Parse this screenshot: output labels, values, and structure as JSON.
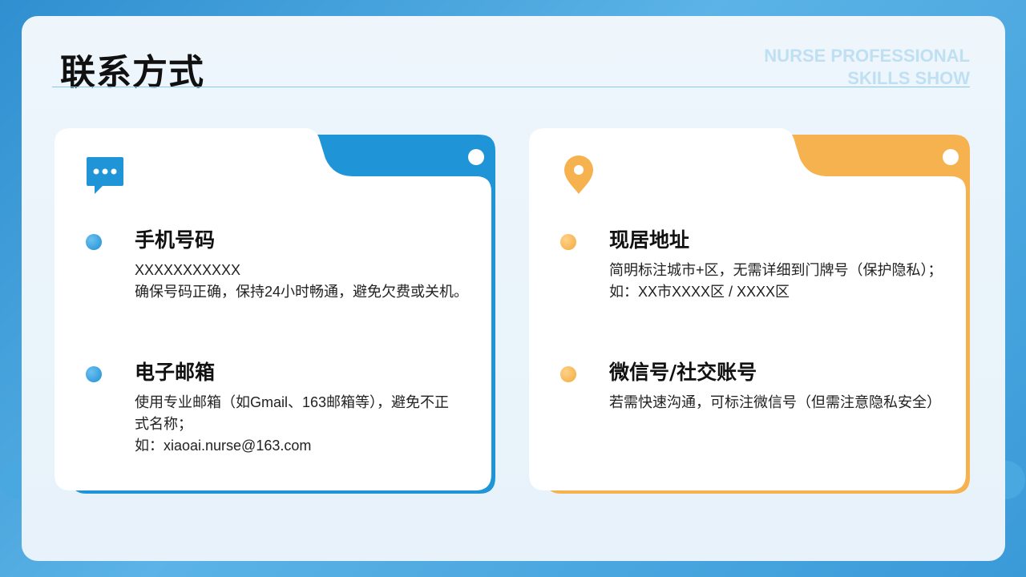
{
  "page": {
    "title": "联系方式",
    "subtitle_lines": [
      "NURSE PROFESSIONAL",
      "SKILLS SHOW"
    ]
  },
  "colors": {
    "accent_blue": "#1f95d8",
    "accent_orange": "#f5b24f",
    "background_blue": "#3a9ad8",
    "title_text": "#111111"
  },
  "cards": {
    "phone_card": {
      "icon": "chat-bubble-icon",
      "items": [
        {
          "heading": "手机号码",
          "lines": [
            "XXXXXXXXXXX",
            "确保号码正确，保持24小时畅通，避免欠费或关机。"
          ]
        },
        {
          "heading": "电子邮箱",
          "lines": [
            "使用专业邮箱（如Gmail、163邮箱等），避免不正",
            "式名称；",
            "如：xiaoai.nurse@163.com"
          ]
        }
      ]
    },
    "address_card": {
      "icon": "location-pin-icon",
      "items": [
        {
          "heading": "现居地址",
          "lines": [
            "简明标注城市+区，无需详细到门牌号（保护隐私）；",
            "如：XX市XXXX区 / XXXX区"
          ]
        },
        {
          "heading": "微信号/社交账号",
          "lines": [
            "若需快速沟通，可标注微信号（但需注意隐私安全）"
          ]
        }
      ]
    }
  }
}
